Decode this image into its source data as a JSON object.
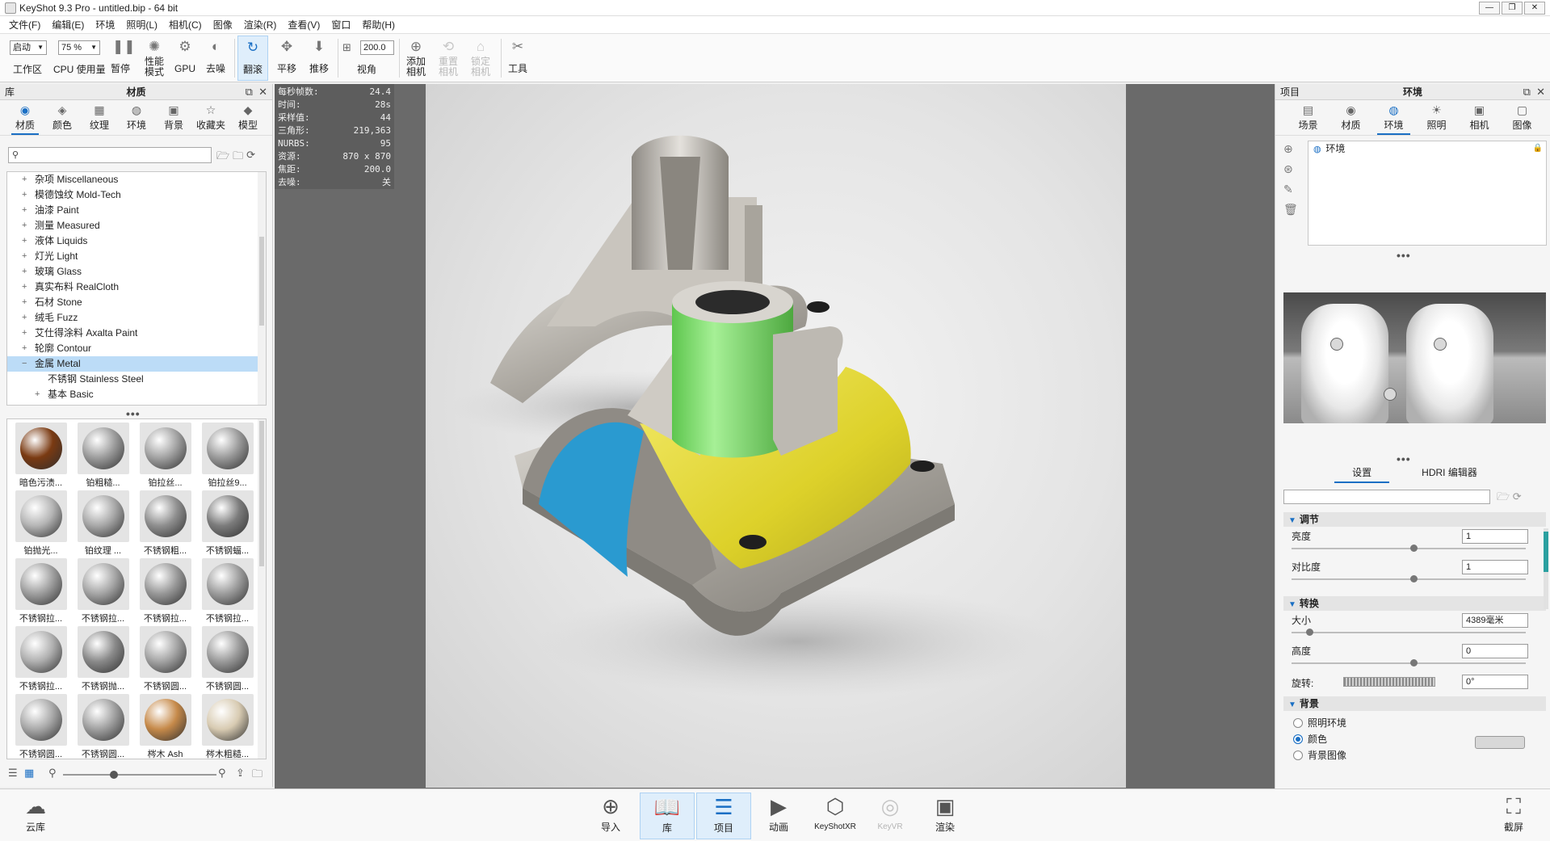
{
  "window": {
    "title": "KeyShot 9.3 Pro  - untitled.bip  - 64 bit",
    "controls": [
      "—",
      "❐",
      "✕"
    ]
  },
  "menu": [
    "文件(F)",
    "编辑(E)",
    "环境",
    "照明(L)",
    "相机(C)",
    "图像",
    "渲染(R)",
    "查看(V)",
    "窗口",
    "帮助(H)"
  ],
  "toolbar": {
    "workspace_select": "启动",
    "workspace_label": "工作区",
    "cpu_select": "75 %",
    "cpu_label": "CPU 使用量",
    "pause_label": "暂停",
    "perf_label": "性能\n模式",
    "gpu_label": "GPU",
    "denoise_label": "去噪",
    "tumble_label": "翻滚",
    "pan_label": "平移",
    "dolly_label": "推移",
    "fov_value": "200.0",
    "fov_label": "视角",
    "add_camera_label": "添加\n相机",
    "reset_camera_label": "重置\n相机",
    "lock_camera_label": "锁定\n相机",
    "tools_label": "工具"
  },
  "library": {
    "header_left": "库",
    "header_title": "材质",
    "tabs": [
      {
        "label": "材质",
        "icon": "material-icon",
        "glyph": "◉",
        "active": true
      },
      {
        "label": "颜色",
        "icon": "color-icon",
        "glyph": "◈",
        "active": false
      },
      {
        "label": "纹理",
        "icon": "texture-icon",
        "glyph": "▦",
        "active": false
      },
      {
        "label": "环境",
        "icon": "environment-icon",
        "glyph": "◍",
        "active": false
      },
      {
        "label": "背景",
        "icon": "background-icon",
        "glyph": "▣",
        "active": false
      },
      {
        "label": "收藏夹",
        "icon": "favorites-icon",
        "glyph": "☆",
        "active": false
      },
      {
        "label": "模型",
        "icon": "model-icon",
        "glyph": "◆",
        "active": false
      }
    ],
    "search_placeholder": "",
    "tree": [
      {
        "label": "杂项 Miscellaneous",
        "exp": "+",
        "child": false,
        "selected": false
      },
      {
        "label": "模德蚀纹 Mold-Tech",
        "exp": "+",
        "child": false,
        "selected": false
      },
      {
        "label": "油漆 Paint",
        "exp": "+",
        "child": false,
        "selected": false
      },
      {
        "label": "测量 Measured",
        "exp": "+",
        "child": false,
        "selected": false
      },
      {
        "label": "液体 Liquids",
        "exp": "+",
        "child": false,
        "selected": false
      },
      {
        "label": "灯光 Light",
        "exp": "+",
        "child": false,
        "selected": false
      },
      {
        "label": "玻璃 Glass",
        "exp": "+",
        "child": false,
        "selected": false
      },
      {
        "label": "真实布料 RealCloth",
        "exp": "+",
        "child": false,
        "selected": false
      },
      {
        "label": "石材 Stone",
        "exp": "+",
        "child": false,
        "selected": false
      },
      {
        "label": "绒毛 Fuzz",
        "exp": "+",
        "child": false,
        "selected": false
      },
      {
        "label": "艾仕得涂料 Axalta Paint",
        "exp": "+",
        "child": false,
        "selected": false
      },
      {
        "label": "轮廓 Contour",
        "exp": "+",
        "child": false,
        "selected": false
      },
      {
        "label": "金属 Metal",
        "exp": "−",
        "child": false,
        "selected": true
      },
      {
        "label": "不锈钢 Stainless Steel",
        "exp": "",
        "child": true,
        "selected": false
      },
      {
        "label": "基本 Basic",
        "exp": "+",
        "child": true,
        "selected": false
      }
    ],
    "thumbnails": [
      {
        "label": "暗色污渍...",
        "color": "#7a3a12"
      },
      {
        "label": "铂粗糙...",
        "color": "#9c9c9c"
      },
      {
        "label": "铂拉丝...",
        "color": "#a2a2a2"
      },
      {
        "label": "铂拉丝9...",
        "color": "#9a9a9a"
      },
      {
        "label": "铂抛光...",
        "color": "#b5b5b5"
      },
      {
        "label": "铂纹理 ...",
        "color": "#a8a8a8"
      },
      {
        "label": "不锈钢粗...",
        "color": "#8f8f8f"
      },
      {
        "label": "不锈钢蝠...",
        "color": "#7c7c7c"
      },
      {
        "label": "不锈钢拉...",
        "color": "#a0a0a0"
      },
      {
        "label": "不锈钢拉...",
        "color": "#a6a6a6"
      },
      {
        "label": "不锈钢拉...",
        "color": "#999999"
      },
      {
        "label": "不锈钢拉...",
        "color": "#9e9e9e"
      },
      {
        "label": "不锈钢拉...",
        "color": "#b0b0b0"
      },
      {
        "label": "不锈钢抛...",
        "color": "#8a8a8a"
      },
      {
        "label": "不锈钢圆...",
        "color": "#a4a4a4"
      },
      {
        "label": "不锈钢圆...",
        "color": "#9b9b9b"
      },
      {
        "label": "不锈钢圆...",
        "color": "#a9a9a9"
      },
      {
        "label": "不锈钢圆...",
        "color": "#a0a0a0"
      },
      {
        "label": "梣木 Ash",
        "color": "#c68a4a"
      },
      {
        "label": "梣木粗糙...",
        "color": "#d8cbb2"
      }
    ]
  },
  "stats": [
    {
      "k": "每秒帧数:",
      "v": "24.4"
    },
    {
      "k": "时间:",
      "v": "28s"
    },
    {
      "k": "采样值:",
      "v": "44"
    },
    {
      "k": "三角形:",
      "v": "219,363"
    },
    {
      "k": "NURBS:",
      "v": "95"
    },
    {
      "k": "资源:",
      "v": "870 x 870"
    },
    {
      "k": "焦距:",
      "v": "200.0"
    },
    {
      "k": "去噪:",
      "v": "关"
    }
  ],
  "project": {
    "header_left": "项目",
    "header_title": "环境",
    "tabs": [
      {
        "label": "场景",
        "icon": "scene-icon",
        "glyph": "▤",
        "active": false
      },
      {
        "label": "材质",
        "icon": "material-icon",
        "glyph": "◉",
        "active": false
      },
      {
        "label": "环境",
        "icon": "environment-icon",
        "glyph": "◍",
        "active": true
      },
      {
        "label": "照明",
        "icon": "lighting-icon",
        "glyph": "☀",
        "active": false
      },
      {
        "label": "相机",
        "icon": "camera-icon",
        "glyph": "▣",
        "active": false
      },
      {
        "label": "图像",
        "icon": "image-icon",
        "glyph": "▢",
        "active": false
      }
    ],
    "scene_item": "环境",
    "sub_tabs": [
      {
        "label": "设置",
        "active": true
      },
      {
        "label": "HDRI 编辑器",
        "active": false
      }
    ],
    "sections": {
      "adjust": "调节",
      "transform": "转换",
      "background": "背景"
    },
    "props": {
      "brightness_label": "亮度",
      "brightness_value": "1",
      "contrast_label": "对比度",
      "contrast_value": "1",
      "size_label": "大小",
      "size_value": "4389毫米",
      "height_label": "高度",
      "height_value": "0",
      "rotation_label": "旋转:",
      "rotation_value": "0°"
    },
    "background_options": [
      {
        "label": "照明环境",
        "checked": false
      },
      {
        "label": "颜色",
        "checked": true
      },
      {
        "label": "背景图像",
        "checked": false
      }
    ]
  },
  "bottom": {
    "cloud_label": "云库",
    "import_label": "导入",
    "library_label": "库",
    "project_label": "项目",
    "animation_label": "动画",
    "keyshotxr_label": "KeyShotXR",
    "keyvr_label": "KeyVR",
    "render_label": "渲染",
    "screenshot_label": "截屏"
  },
  "colors": {
    "accent": "#1a6fc4",
    "selection": "#bcdcf7",
    "part_green": "#7fe06a",
    "part_yellow": "#e4d832",
    "part_blue": "#2a9ad0",
    "steel": "#b8b4ad"
  }
}
